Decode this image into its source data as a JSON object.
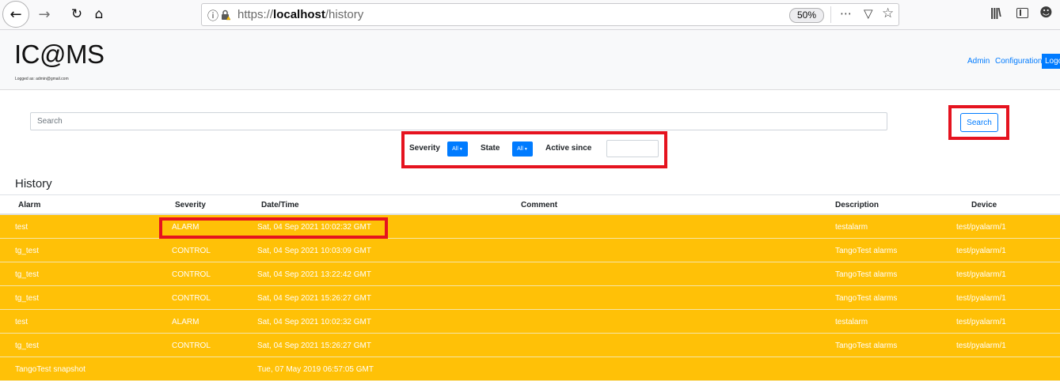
{
  "browser": {
    "url_prefix": "https://",
    "url_host": "localhost",
    "url_path": "/history",
    "zoom": "50%",
    "icons": [
      "back-icon",
      "forward-icon",
      "reload-icon",
      "home-icon",
      "info-icon",
      "lock-warning-icon",
      "page-actions-icon",
      "pocket-icon",
      "bookmark-star-icon",
      "library-icon",
      "sidebar-icon",
      "account-icon"
    ]
  },
  "header": {
    "logo": "IC@MS",
    "logged_as": "Logged as: admin@gmail.com",
    "nav_admin": "Admin",
    "nav_config": "Configuration",
    "logout": "Logout"
  },
  "search": {
    "placeholder": "Search",
    "button_label": "Search"
  },
  "filters": {
    "severity_label": "Severity",
    "severity_value": "All",
    "state_label": "State",
    "state_value": "All",
    "active_since_label": "Active since",
    "active_since_value": ""
  },
  "history": {
    "title": "History",
    "columns": {
      "alarm": "Alarm",
      "severity": "Severity",
      "datetime": "Date/Time",
      "comment": "Comment",
      "description": "Description",
      "device": "Device"
    },
    "rows": [
      {
        "alarm": "test",
        "severity": "ALARM",
        "datetime": "Sat, 04 Sep 2021 10:02:32 GMT",
        "comment": "",
        "description": "testalarm",
        "device": "test/pyalarm/1"
      },
      {
        "alarm": "tg_test",
        "severity": "CONTROL",
        "datetime": "Sat, 04 Sep 2021 10:03:09 GMT",
        "comment": "",
        "description": "TangoTest alarms",
        "device": "test/pyalarm/1"
      },
      {
        "alarm": "tg_test",
        "severity": "CONTROL",
        "datetime": "Sat, 04 Sep 2021 13:22:42 GMT",
        "comment": "",
        "description": "TangoTest alarms",
        "device": "test/pyalarm/1"
      },
      {
        "alarm": "tg_test",
        "severity": "CONTROL",
        "datetime": "Sat, 04 Sep 2021 15:26:27 GMT",
        "comment": "",
        "description": "TangoTest alarms",
        "device": "test/pyalarm/1"
      },
      {
        "alarm": "test",
        "severity": "ALARM",
        "datetime": "Sat, 04 Sep 2021 10:02:32 GMT",
        "comment": "",
        "description": "testalarm",
        "device": "test/pyalarm/1"
      },
      {
        "alarm": "tg_test",
        "severity": "CONTROL",
        "datetime": "Sat, 04 Sep 2021 15:26:27 GMT",
        "comment": "",
        "description": "TangoTest alarms",
        "device": "test/pyalarm/1"
      },
      {
        "alarm": "TangoTest snapshot",
        "severity": "",
        "datetime": "Tue, 07 May 2019 06:57:05 GMT",
        "comment": "",
        "description": "",
        "device": ""
      }
    ]
  },
  "colors": {
    "row_background": "#ffc107",
    "primary": "#007bff",
    "highlight": "#e5131f"
  }
}
